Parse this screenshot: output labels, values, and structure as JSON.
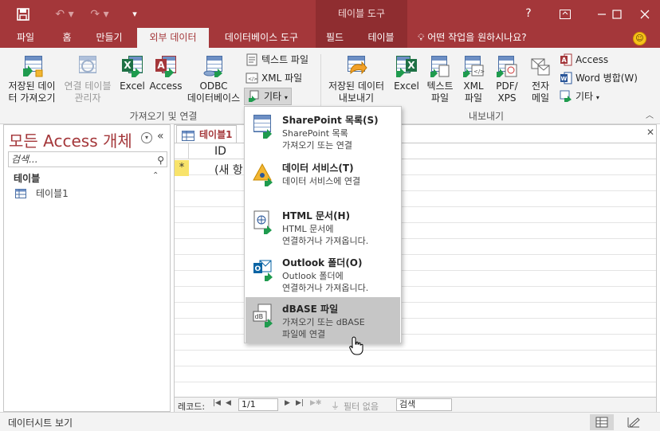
{
  "colors": {
    "accent": "#a4373a",
    "context_tab": "#8f2d30",
    "excel": "#1e7145",
    "hover": "#c6c6c6",
    "new_record": "#f8e36b"
  },
  "titlebar": {
    "context_title": "테이블 도구",
    "help": "?",
    "icons": [
      "save-icon",
      "undo-icon",
      "redo-icon",
      "qat-customize-icon"
    ]
  },
  "tabs": [
    {
      "label": "파일"
    },
    {
      "label": "홈"
    },
    {
      "label": "만들기"
    },
    {
      "label": "외부 데이터",
      "active": true
    },
    {
      "label": "데이터베이스 도구"
    },
    {
      "label": "필드"
    },
    {
      "label": "테이블"
    }
  ],
  "tellme": "어떤 작업을 원하시나요?",
  "ribbon": {
    "import_group": {
      "label": "가져오기 및 연결",
      "saved_imports": [
        "저장된 데이",
        "터 가져오기"
      ],
      "linked_table_manager": [
        "연결 테이블",
        "관리자"
      ],
      "excel": "Excel",
      "access": "Access",
      "odbc": [
        "ODBC",
        "데이터베이스"
      ],
      "text_file": "텍스트 파일",
      "xml_file": "XML 파일",
      "more": "기타"
    },
    "export_group": {
      "label": "내보내기",
      "saved_exports": [
        "저장된 데이터",
        "내보내기"
      ],
      "excel": "Excel",
      "text_file": [
        "텍스트",
        "파일"
      ],
      "xml_file": [
        "XML",
        "파일"
      ],
      "pdf_xps": [
        "PDF/",
        "XPS"
      ],
      "email": [
        "전자",
        "메일"
      ],
      "access": "Access",
      "word_merge": "Word 병합(W)",
      "more": "기타"
    }
  },
  "navpane": {
    "title": "모든 Access 개체",
    "search_placeholder": "검색...",
    "group": "테이블",
    "items": [
      "테이블1"
    ]
  },
  "document": {
    "tab": "테이블1",
    "header_id": "ID",
    "new_record_marker": "*",
    "new_record_text": "(새 항"
  },
  "record_nav": {
    "label": "레코드:",
    "position": "1/1",
    "filter": "필터 없음",
    "search": "검색"
  },
  "dropdown": [
    {
      "title": "SharePoint 목록(S)",
      "desc": [
        "SharePoint 목록",
        "가져오기 또는 연결"
      ],
      "icon": "sharepoint-icon"
    },
    {
      "title": "데이터 서비스(T)",
      "desc": [
        "데이터 서비스에 연결"
      ],
      "icon": "data-service-icon"
    },
    {
      "title": "HTML 문서(H)",
      "desc": [
        "HTML 문서에",
        "연결하거나 가져옵니다."
      ],
      "icon": "html-icon"
    },
    {
      "title": "Outlook 폴더(O)",
      "desc": [
        "Outlook 폴더에",
        "연결하거나 가져옵니다."
      ],
      "icon": "outlook-icon"
    },
    {
      "title": "dBASE 파일",
      "desc": [
        "가져오기 또는 dBASE",
        "파일에 연결"
      ],
      "icon": "dbase-icon",
      "hover": true
    }
  ],
  "statusbar": {
    "text": "데이터시트 보기"
  }
}
